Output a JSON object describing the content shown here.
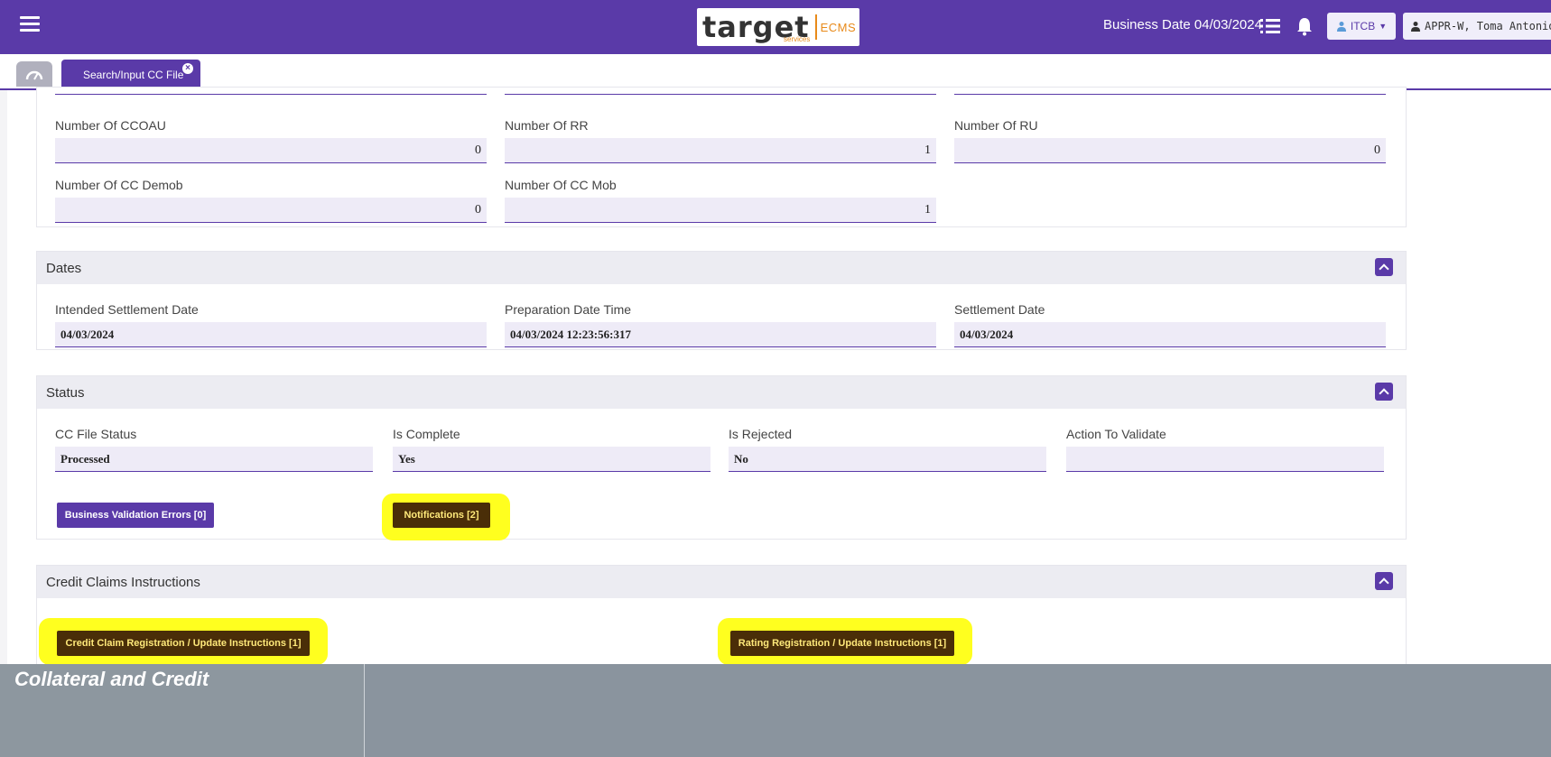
{
  "header": {
    "logo_text": "target",
    "logo_sub": "services",
    "logo_product": "ECMS",
    "business_date": "Business Date 04/03/2024",
    "itcb_label": "ITCB",
    "user_label": "APPR-W, Toma Antonio"
  },
  "tabs": {
    "active_label": "Search/Input CC File"
  },
  "counts": {
    "ccoau": {
      "label": "Number Of CCOAU",
      "value": "0"
    },
    "rr": {
      "label": "Number Of RR",
      "value": "1"
    },
    "ru": {
      "label": "Number Of RU",
      "value": "0"
    },
    "cc_demob": {
      "label": "Number Of CC Demob",
      "value": "0"
    },
    "cc_mob": {
      "label": "Number Of CC Mob",
      "value": "1"
    }
  },
  "dates": {
    "title": "Dates",
    "intended_label": "Intended Settlement Date",
    "intended_value": "04/03/2024",
    "prep_label": "Preparation Date Time",
    "prep_value": "04/03/2024 12:23:56:317",
    "settle_label": "Settlement Date",
    "settle_value": "04/03/2024"
  },
  "status": {
    "title": "Status",
    "file_status_label": "CC File Status",
    "file_status_value": "Processed",
    "complete_label": "Is Complete",
    "complete_value": "Yes",
    "rejected_label": "Is Rejected",
    "rejected_value": "No",
    "action_label": "Action To Validate",
    "action_value": "",
    "bve_button": "Business Validation Errors [0]",
    "notifications_button": "Notifications [2]"
  },
  "credit_claims": {
    "title": "Credit Claims Instructions",
    "cc_button": "Credit Claim Registration / Update Instructions [1]",
    "rating_button": "Rating Registration / Update Instructions [1]"
  },
  "footer": {
    "title": "Collateral and Credit"
  },
  "colors": {
    "brand_purple": "#5a3aa8",
    "field_bg": "#eeebf7",
    "highlight_yellow": "#ffff1f",
    "dark_button": "#4a2e08"
  }
}
